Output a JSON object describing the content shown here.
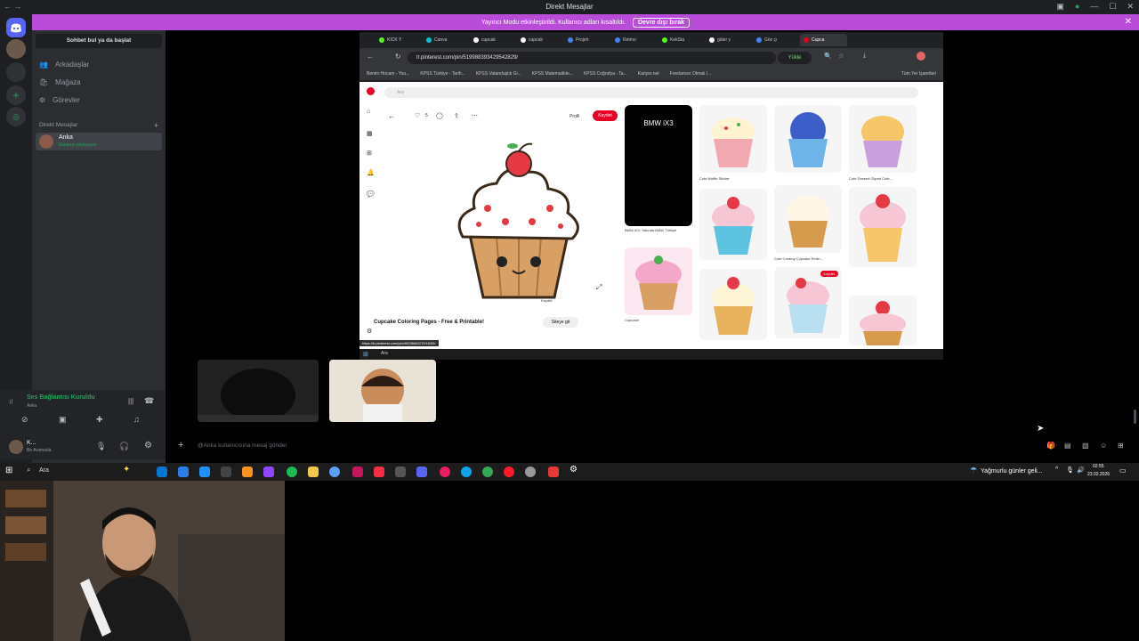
{
  "window": {
    "title": "Direkt Mesajlar"
  },
  "banner": {
    "text": "Yayıncı Modu etkinleştirildi. Kullanıcı adları kısaltıldı.",
    "button": "Devre dışı bırak",
    "color": "#b84bd8"
  },
  "sidebar": {
    "search_label": "Sohbet bul ya da başlat",
    "nav": [
      {
        "label": "Arkadaşlar",
        "icon": "friends-icon"
      },
      {
        "label": "Mağaza",
        "icon": "shop-icon"
      },
      {
        "label": "Görevler",
        "icon": "quests-icon"
      }
    ],
    "dm_header": "Direkt Mesajlar",
    "dm": {
      "name": "Anka",
      "status": "Ekranını paylaşıyor"
    }
  },
  "voice": {
    "status": "Ses Bağlantısı Kuruldu",
    "channel": "Anka",
    "status_color": "#23a55a"
  },
  "user": {
    "name": "K...",
    "status": "Bir Aramada"
  },
  "stream": {
    "browser": {
      "tabs": [
        "KICK Y",
        "Canva",
        "cupcak",
        "cupcak",
        "Projelr",
        "Retmo",
        "KekSta",
        "güler y",
        "Göz çı",
        "Cupca"
      ],
      "url": "tr.pinterest.com/pin/519988393429542829/",
      "save_btn": "Yükle",
      "bookmarks": [
        "Benim Hocam - You...",
        "KPSS Türkiye - Tarih...",
        "KPSS Vatandaşlık Gi...",
        "KPSS Matematikte...",
        "KPSS Coğrafya - Ta...",
        "Kariyer.net",
        "Freelancer Olmak İ...",
        "Tüm Yer İşaretleri"
      ],
      "page": {
        "search_placeholder": "Ara",
        "profile_label": "Profil",
        "save_label": "Kaydet",
        "likes": "5",
        "pin_title": "Cupcake Coloring Pages - Free & Printable!",
        "visit_label": "Siteye git",
        "grid_captions": [
          "BMW iX3",
          "Cute Muffin Sticker",
          "Cute Dessert Clipart Cute...",
          "BMW iX3: Yakında BMW Türkiye",
          "Cute Creamy Cupcake Emlin...",
          "Cupcake",
          "Cupcake"
        ],
        "status_link": "https://tr.pinterest.com/pin/45036683729162I9/"
      },
      "inner_search": "Ara"
    }
  },
  "message_placeholder": "@Anka kullanıcısına mesaj gönder",
  "taskbar": {
    "search": "Ara",
    "weather": "Yağmurlu günler geli...",
    "time": "02:55",
    "date": "23.02.2026"
  }
}
